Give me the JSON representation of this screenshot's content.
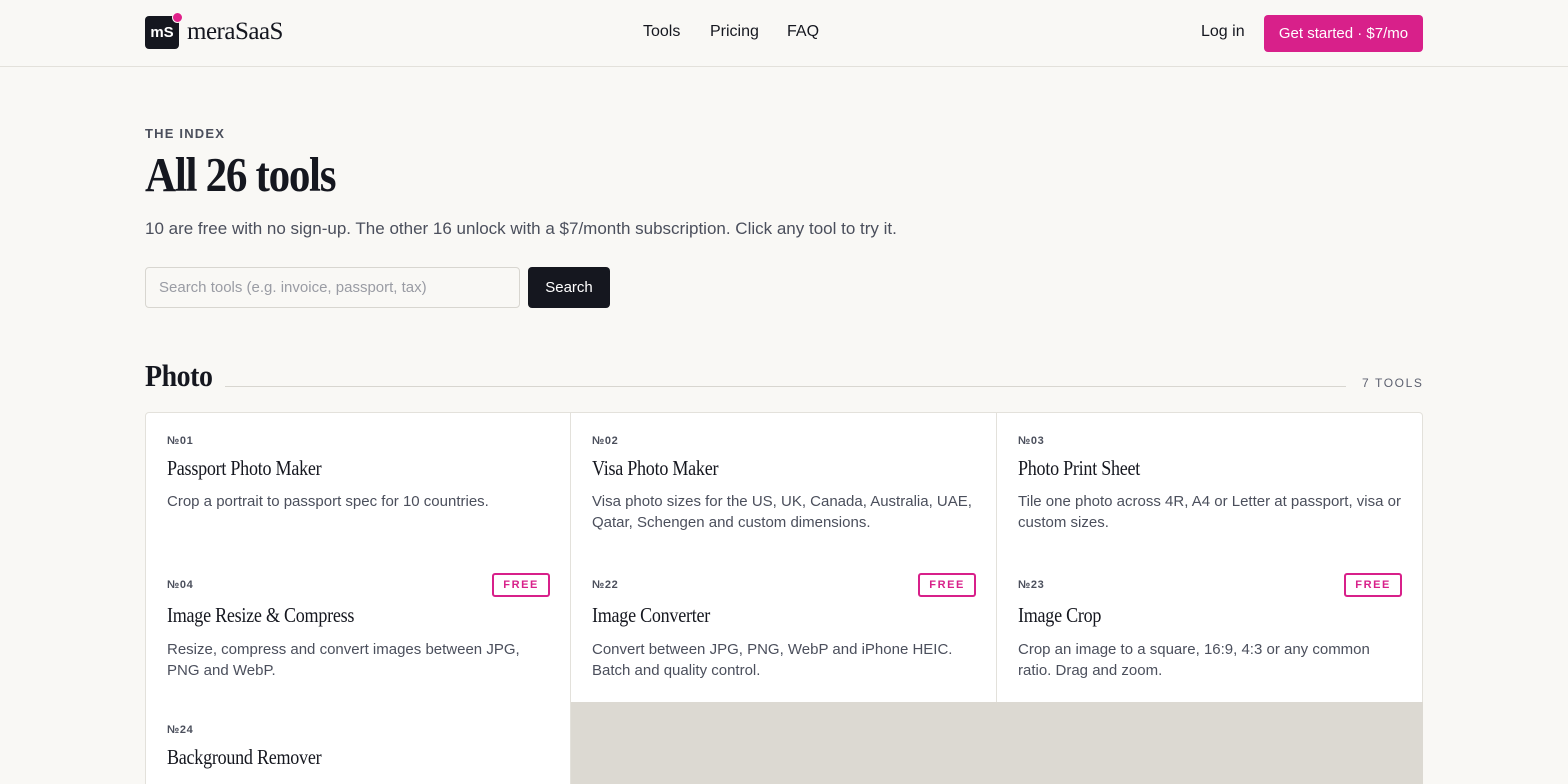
{
  "header": {
    "logo_mark": "mS",
    "logo_text": "meraSaaS",
    "nav": [
      "Tools",
      "Pricing",
      "FAQ"
    ],
    "login": "Log in",
    "cta": "Get started · $7/mo",
    "brand_color": "#d8208a"
  },
  "hero": {
    "eyebrow": "THE INDEX",
    "title": "All 26 tools",
    "subtitle": "10 are free with no sign-up. The other 16 unlock with a $7/month subscription. Click any tool to try it.",
    "search_placeholder": "Search tools (e.g. invoice, passport, tax)",
    "search_button": "Search"
  },
  "section": {
    "title": "Photo",
    "count": "7 TOOLS",
    "cards": [
      {
        "num": "№01",
        "title": "Passport Photo Maker",
        "desc": "Crop a portrait to passport spec for 10 countries.",
        "badge": ""
      },
      {
        "num": "№02",
        "title": "Visa Photo Maker",
        "desc": "Visa photo sizes for the US, UK, Canada, Australia, UAE, Qatar, Schengen and custom dimensions.",
        "badge": ""
      },
      {
        "num": "№03",
        "title": "Photo Print Sheet",
        "desc": "Tile one photo across 4R, A4 or Letter at passport, visa or custom sizes.",
        "badge": ""
      },
      {
        "num": "№04",
        "title": "Image Resize & Compress",
        "desc": "Resize, compress and convert images between JPG, PNG and WebP.",
        "badge": "FREE"
      },
      {
        "num": "№22",
        "title": "Image Converter",
        "desc": "Convert between JPG, PNG, WebP and iPhone HEIC. Batch and quality control.",
        "badge": "FREE"
      },
      {
        "num": "№23",
        "title": "Image Crop",
        "desc": "Crop an image to a square, 16:9, 4:3 or any common ratio. Drag and zoom.",
        "badge": "FREE"
      },
      {
        "num": "№24",
        "title": "Background Remover",
        "desc": "",
        "badge": ""
      }
    ]
  }
}
